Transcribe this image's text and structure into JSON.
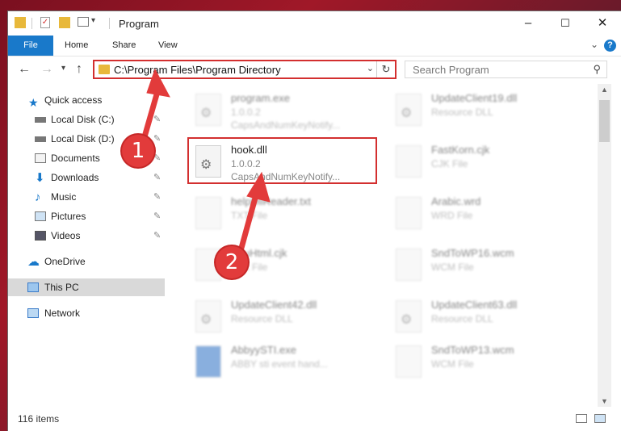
{
  "window": {
    "title": "Program",
    "controls": {
      "minimize": "–",
      "maximize": "☐",
      "close": "✕"
    }
  },
  "ribbon": {
    "tabs": [
      "File",
      "Home",
      "Share",
      "View"
    ],
    "help": "?"
  },
  "address": {
    "path": "C:\\Program Files\\Program Directory",
    "search_placeholder": "Search Program"
  },
  "nav": {
    "items": [
      {
        "label": "Quick access",
        "icon": "star-icon"
      },
      {
        "label": "Local Disk (C:)",
        "icon": "drive-icon"
      },
      {
        "label": "Local Disk (D:)",
        "icon": "drive-icon"
      },
      {
        "label": "Documents",
        "icon": "documents-icon"
      },
      {
        "label": "Downloads",
        "icon": "download-icon"
      },
      {
        "label": "Music",
        "icon": "music-icon"
      },
      {
        "label": "Pictures",
        "icon": "pictures-icon"
      },
      {
        "label": "Videos",
        "icon": "videos-icon"
      },
      {
        "label": "OneDrive",
        "icon": "cloud-icon"
      },
      {
        "label": "This PC",
        "icon": "computer-icon"
      },
      {
        "label": "Network",
        "icon": "network-icon"
      }
    ]
  },
  "files": [
    {
      "name": "program.exe",
      "line2": "1.0.0.2",
      "line3": "CapsAndNumKeyNotify..."
    },
    {
      "name": "hook.dll",
      "line2": "1.0.0.2",
      "line3": "CapsAndNumKeyNotify..."
    },
    {
      "name": "helpDllReader.txt",
      "line2": "TXT File",
      "line3": ""
    },
    {
      "name": "EnuHtml.cjk",
      "line2": "CJK File",
      "line3": ""
    },
    {
      "name": "UpdateClient42.dll",
      "line2": "Resource DLL",
      "line3": ""
    },
    {
      "name": "AbbyySTI.exe",
      "line2": "ABBY sti event hand...",
      "line3": ""
    },
    {
      "name": "UpdateClient19.dll",
      "line2": "Resource DLL",
      "line3": ""
    },
    {
      "name": "FastKorn.cjk",
      "line2": "CJK File",
      "line3": ""
    },
    {
      "name": "Arabic.wrd",
      "line2": "WRD File",
      "line3": ""
    },
    {
      "name": "SndToWP16.wcm",
      "line2": "WCM File",
      "line3": ""
    },
    {
      "name": "UpdateClient63.dll",
      "line2": "Resource DLL",
      "line3": ""
    },
    {
      "name": "SndToWP13.wcm",
      "line2": "WCM File",
      "line3": ""
    }
  ],
  "status": {
    "count": "116 items"
  },
  "callouts": [
    "1",
    "2"
  ],
  "colors": {
    "accent": "#1979ca",
    "highlight": "#d32f2f"
  }
}
